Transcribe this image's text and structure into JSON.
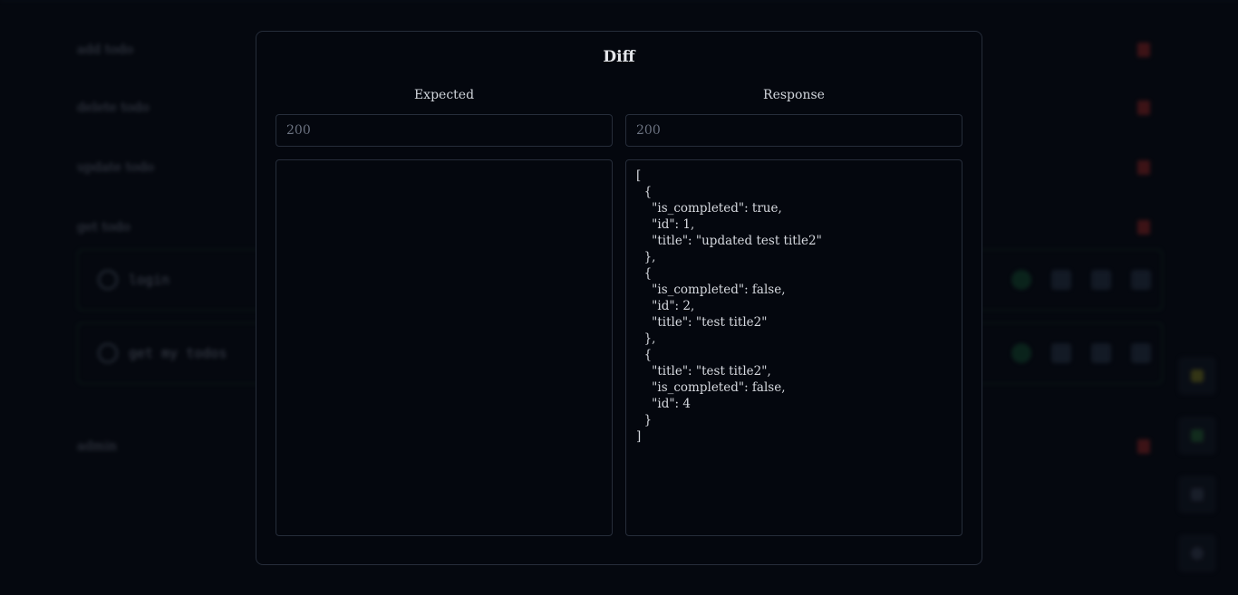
{
  "background": {
    "rows": [
      {
        "label": "add todo"
      },
      {
        "label": "delete todo"
      },
      {
        "label": "update todo"
      },
      {
        "label": "get todo"
      }
    ],
    "cards": [
      {
        "name": "login"
      },
      {
        "name": "get my todos"
      }
    ],
    "footer_row": {
      "label": "admin"
    },
    "colors": {
      "trash": "#6b1d1d",
      "card_border": "#173424"
    }
  },
  "diff_modal": {
    "title": "Diff",
    "expected": {
      "heading": "Expected",
      "status": "200",
      "body": ""
    },
    "response": {
      "heading": "Response",
      "status": "200",
      "body": "[\n  {\n    \"is_completed\": true,\n    \"id\": 1,\n    \"title\": \"updated test title2\"\n  },\n  {\n    \"is_completed\": false,\n    \"id\": 2,\n    \"title\": \"test title2\"\n  },\n  {\n    \"title\": \"test title2\",\n    \"is_completed\": false,\n    \"id\": 4\n  }\n]"
    }
  }
}
